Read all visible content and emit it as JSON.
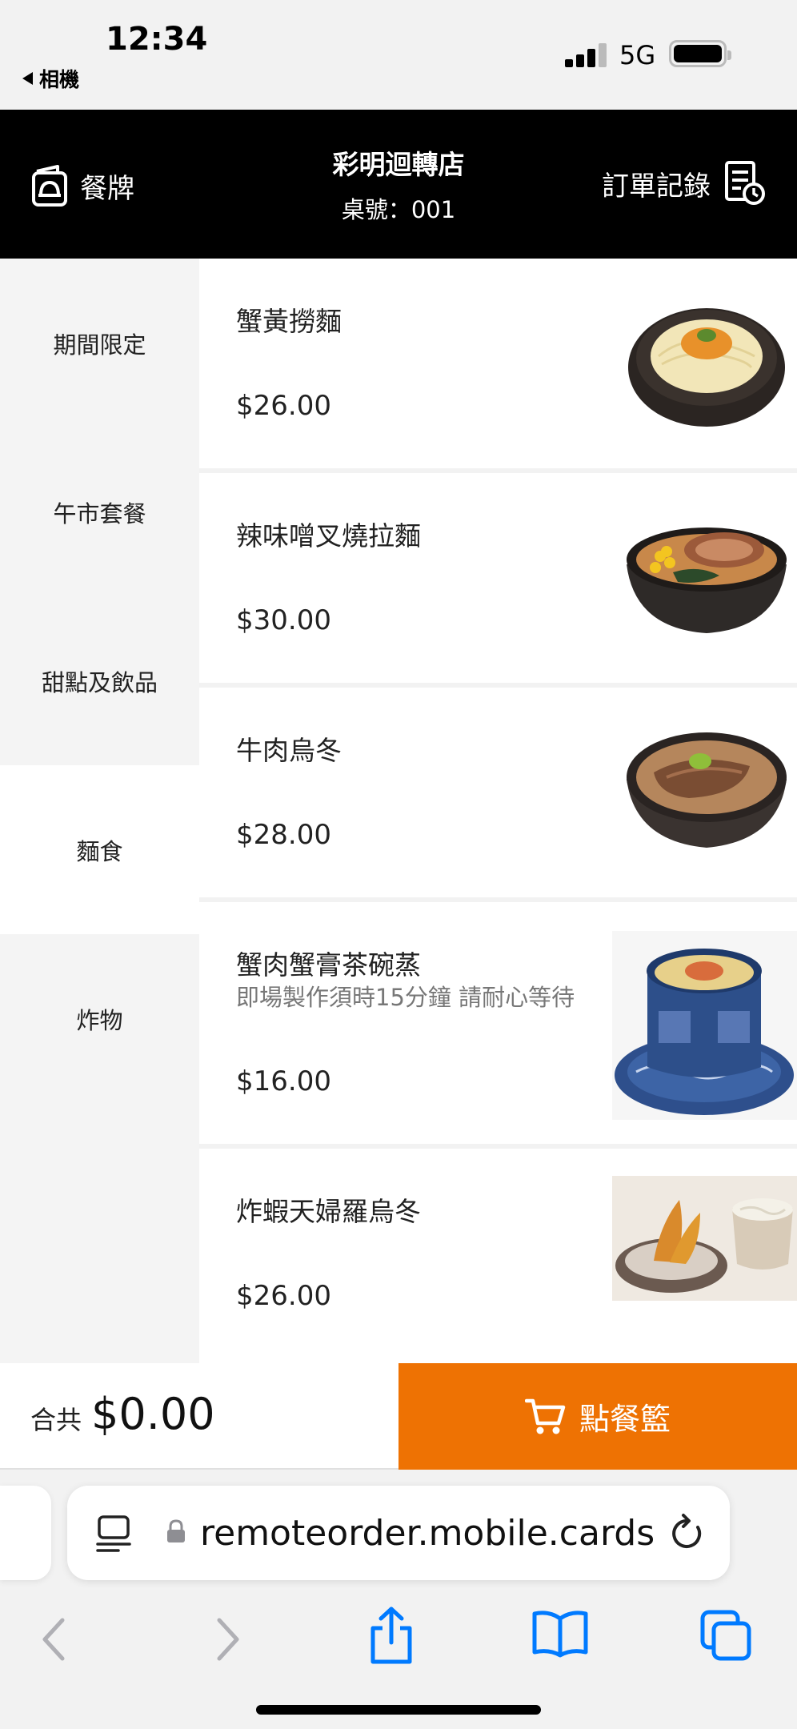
{
  "status": {
    "time": "12:34",
    "back_label": "相機",
    "network": "5G"
  },
  "header": {
    "menu_label": "餐牌",
    "store_name": "彩明迴轉店",
    "table_number": "桌號：001",
    "orders_label": "訂單記錄"
  },
  "sidebar": {
    "categories": [
      {
        "label": "期間限定",
        "active": false
      },
      {
        "label": "午市套餐",
        "active": false
      },
      {
        "label": "甜點及飲品",
        "active": false
      },
      {
        "label": "麵食",
        "active": true
      },
      {
        "label": "炸物",
        "active": false
      }
    ]
  },
  "menu_items": [
    {
      "name": "蟹黃撈麵",
      "description": "",
      "price": "$26.00",
      "image": "crab-roe-noodles"
    },
    {
      "name": "辣味噌叉燒拉麵",
      "description": "",
      "price": "$30.00",
      "image": "spicy-miso-chashu-ramen"
    },
    {
      "name": "牛肉烏冬",
      "description": "",
      "price": "$28.00",
      "image": "beef-udon"
    },
    {
      "name": "蟹肉蟹膏茶碗蒸",
      "description": "即場製作須時15分鐘 請耐心等待",
      "price": "$16.00",
      "image": "chawanmushi"
    },
    {
      "name": "炸蝦天婦羅烏冬",
      "description": "",
      "price": "$26.00",
      "image": "tempura-udon"
    }
  ],
  "footer": {
    "total_label": "合共",
    "total_amount": "$0.00",
    "cart_label": "點餐籃"
  },
  "browser": {
    "url": "remoteorder.mobile.cards"
  },
  "colors": {
    "accent": "#ee7203",
    "header_bg": "#000000",
    "ios_blue": "#007aff"
  }
}
